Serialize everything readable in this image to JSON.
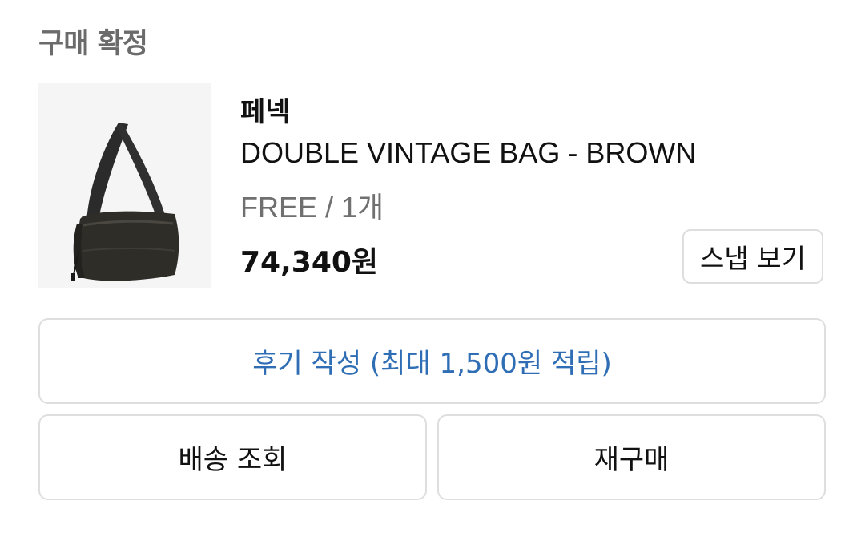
{
  "section": {
    "title": "구매 확정"
  },
  "product": {
    "image_icon": "bag-image",
    "brand": "페넥",
    "name": "DOUBLE VINTAGE BAG - BROWN",
    "option": "FREE / 1개",
    "price": "74,340원"
  },
  "actions": {
    "snap_label": "스냅 보기",
    "review_label": "후기 작성 (최대 1,500원 적립)",
    "delivery_label": "배송 조회",
    "rebuy_label": "재구매"
  },
  "colors": {
    "review_text": "#2f6eb5",
    "title_text": "#6b6b6b",
    "border": "#dedede"
  }
}
